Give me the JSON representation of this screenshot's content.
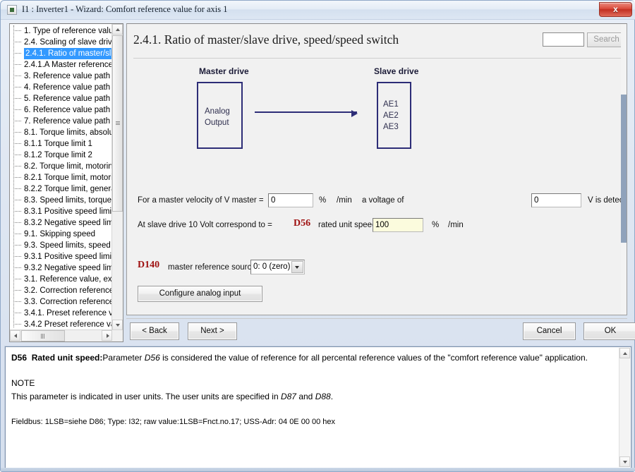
{
  "window": {
    "title": "I1 : Inverter1 - Wizard: Comfort reference value for axis 1",
    "close_label": "x"
  },
  "tree": {
    "items": [
      {
        "label": "1. Type of reference valu",
        "selected": false
      },
      {
        "label": "2.4. Scaling of slave drive",
        "selected": false
      },
      {
        "label": "2.4.1. Ratio of master/sla",
        "selected": true
      },
      {
        "label": "2.4.1.A Master reference",
        "selected": false
      },
      {
        "label": "3. Reference value path",
        "selected": false
      },
      {
        "label": "4. Reference value path",
        "selected": false
      },
      {
        "label": "5. Reference value path",
        "selected": false
      },
      {
        "label": "6. Reference value path",
        "selected": false
      },
      {
        "label": "7. Reference value path",
        "selected": false
      },
      {
        "label": "8.1. Torque limits, absolut",
        "selected": false
      },
      {
        "label": "8.1.1 Torque limit 1",
        "selected": false
      },
      {
        "label": "8.1.2 Torque limit 2",
        "selected": false
      },
      {
        "label": "8.2. Torque limit, motoring",
        "selected": false
      },
      {
        "label": "8.2.1 Torque limit, motorin",
        "selected": false
      },
      {
        "label": "8.2.2 Torque limit, genera",
        "selected": false
      },
      {
        "label": "8.3. Speed limits, torque c",
        "selected": false
      },
      {
        "label": "8.3.1 Positive speed limit",
        "selected": false
      },
      {
        "label": "8.3.2 Negative speed limi",
        "selected": false
      },
      {
        "label": "9.1. Skipping speed",
        "selected": false
      },
      {
        "label": "9.3. Speed limits, speed c",
        "selected": false
      },
      {
        "label": "9.3.1 Positive speed limits",
        "selected": false
      },
      {
        "label": "9.3.2 Negative speed limi",
        "selected": false
      },
      {
        "label": "3.1. Reference value, ext",
        "selected": false
      },
      {
        "label": "3.2. Correction reference",
        "selected": false
      },
      {
        "label": "3.3. Correction reference",
        "selected": false
      },
      {
        "label": "3.4.1. Preset reference va",
        "selected": false
      },
      {
        "label": "3.4.2 Preset reference va",
        "selected": false
      }
    ]
  },
  "main": {
    "page_title": "2.4.1. Ratio of master/slave drive, speed/speed switch",
    "search": {
      "value": "",
      "button_label": "Search"
    },
    "diagram": {
      "master_label": "Master drive",
      "master_box_line1": "Analog",
      "master_box_line2": "Output",
      "slave_label": "Slave drive",
      "slave_box_line1": "AE1",
      "slave_box_line2": "AE2",
      "slave_box_line3": "AE3"
    },
    "row1": {
      "label": "For a master velocity of V master =",
      "velocity_value": "0",
      "unit_percent": "%",
      "unit_per_min": "/min",
      "mid_label": "a voltage of",
      "voltage_value": "0",
      "voltage_suffix": "V is detected"
    },
    "row2": {
      "label": "At slave drive 10 Volt correspond to =",
      "param_code": "D56",
      "param_name": "rated unit speed",
      "value": "100",
      "unit_percent": "%",
      "unit_per_min": "/min"
    },
    "row3": {
      "param_code": "D140",
      "param_name": "master reference source",
      "selected_option": "0: 0 (zero)",
      "options": [
        "0: 0 (zero)"
      ]
    },
    "configure_button": "Configure analog input"
  },
  "buttons": {
    "back": "< Back",
    "next": "Next >",
    "cancel": "Cancel",
    "ok": "OK"
  },
  "help": {
    "title_code": "D56",
    "title_name": "Rated unit speed:",
    "para1_a": "Parameter ",
    "para1_b": "D56",
    "para1_c": " is considered the value of reference for all percental reference values of the \"comfort reference value\" application.",
    "note_heading": "NOTE",
    "note_a": "This parameter is indicated in user units. The user units are specified in ",
    "note_b": "D87",
    "note_c": " and ",
    "note_d": "D88",
    "note_e": ".",
    "fieldbus": "Fieldbus: 1LSB=siehe D86; Type: I32; raw value:1LSB=Fnct.no.17; USS-Adr: 04 0E 00 00 hex"
  }
}
